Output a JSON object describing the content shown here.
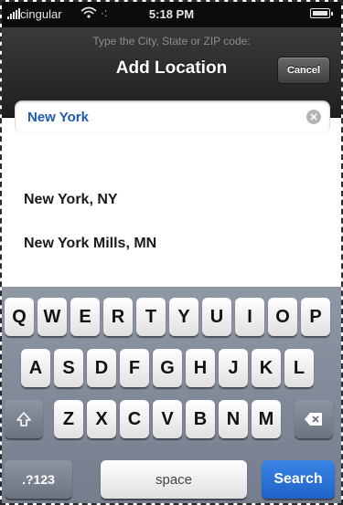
{
  "status_bar": {
    "carrier": "cingular",
    "time": "5:18 PM"
  },
  "header": {
    "prompt": "Type the City, State or ZIP code:",
    "title": "Add Location",
    "cancel_label": "Cancel"
  },
  "search": {
    "value": "New York",
    "clear_icon": "clear-icon"
  },
  "results": [
    {
      "label": "New York, NY"
    },
    {
      "label": "New York Mills, MN"
    }
  ],
  "keyboard": {
    "row1": [
      "Q",
      "W",
      "E",
      "R",
      "T",
      "Y",
      "U",
      "I",
      "O",
      "P"
    ],
    "row2": [
      "A",
      "S",
      "D",
      "F",
      "G",
      "H",
      "J",
      "K",
      "L"
    ],
    "row3": [
      "Z",
      "X",
      "C",
      "V",
      "B",
      "N",
      "M"
    ],
    "shift_icon": "shift-icon",
    "backspace_icon": "backspace-icon",
    "numbers_label": ".?123",
    "space_label": "space",
    "search_label": "Search"
  }
}
